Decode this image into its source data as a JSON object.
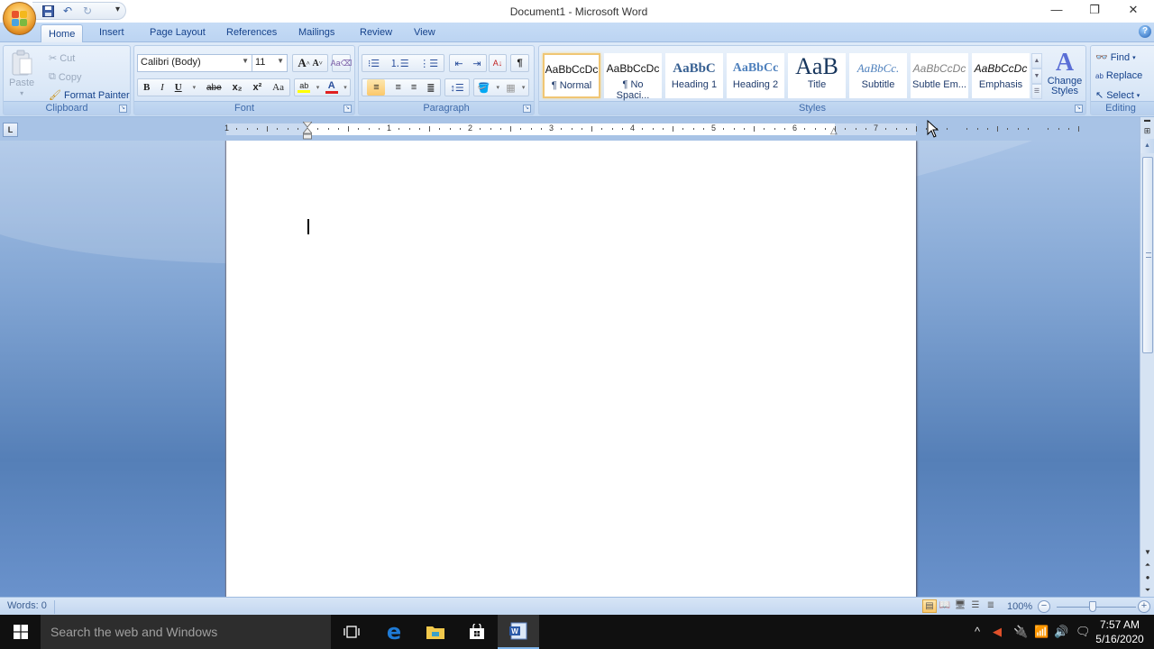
{
  "window": {
    "title": "Document1 - Microsoft Word",
    "controls": {
      "minimize": "—",
      "restore": "❐",
      "close": "✕"
    }
  },
  "qat": {
    "save": "save-icon",
    "undo": "undo-icon",
    "redo": "redo-icon",
    "more": "▾"
  },
  "tabs": [
    {
      "label": "Home",
      "active": true
    },
    {
      "label": "Insert"
    },
    {
      "label": "Page Layout"
    },
    {
      "label": "References"
    },
    {
      "label": "Mailings"
    },
    {
      "label": "Review"
    },
    {
      "label": "View"
    }
  ],
  "ribbon": {
    "clipboard": {
      "label": "Clipboard",
      "paste": "Paste",
      "cut": "Cut",
      "copy": "Copy",
      "format_painter": "Format Painter"
    },
    "font": {
      "label": "Font",
      "font_name": "Calibri (Body)",
      "font_size": "11",
      "grow": "A",
      "shrink": "A",
      "bold": "B",
      "italic": "I",
      "underline": "U",
      "strike": "abe",
      "subscript": "x₂",
      "superscript": "x²",
      "change_case": "Aa",
      "highlight": "ab",
      "font_color": "A",
      "font_color_hex": "#e02020"
    },
    "paragraph": {
      "label": "Paragraph",
      "show_marks": "¶"
    },
    "styles": {
      "label": "Styles",
      "items": [
        {
          "sample": "AaBbCcDc",
          "name": "¶ Normal",
          "selected": true
        },
        {
          "sample": "AaBbCcDc",
          "name": "¶ No Spaci..."
        },
        {
          "sample": "AaBbC",
          "name": "Heading 1"
        },
        {
          "sample": "AaBbCc",
          "name": "Heading 2"
        },
        {
          "sample": "AaB",
          "name": "Title"
        },
        {
          "sample": "AaBbCc.",
          "name": "Subtitle"
        },
        {
          "sample": "AaBbCcDc",
          "name": "Subtle Em..."
        },
        {
          "sample": "AaBbCcDc",
          "name": "Emphasis"
        }
      ],
      "change_styles": "Change Styles"
    },
    "editing": {
      "label": "Editing",
      "find": "Find",
      "replace": "Replace",
      "select": "Select"
    }
  },
  "ruler": {
    "tab_selector": "L",
    "numbers": [
      "1",
      "1",
      "2",
      "3",
      "4",
      "5",
      "6",
      "7"
    ]
  },
  "status": {
    "words": "Words: 0",
    "zoom": "100%",
    "zoom_minus": "−",
    "zoom_plus": "+"
  },
  "taskbar": {
    "search_placeholder": "Search the web and Windows",
    "time": "7:57 AM",
    "date": "5/16/2020"
  }
}
